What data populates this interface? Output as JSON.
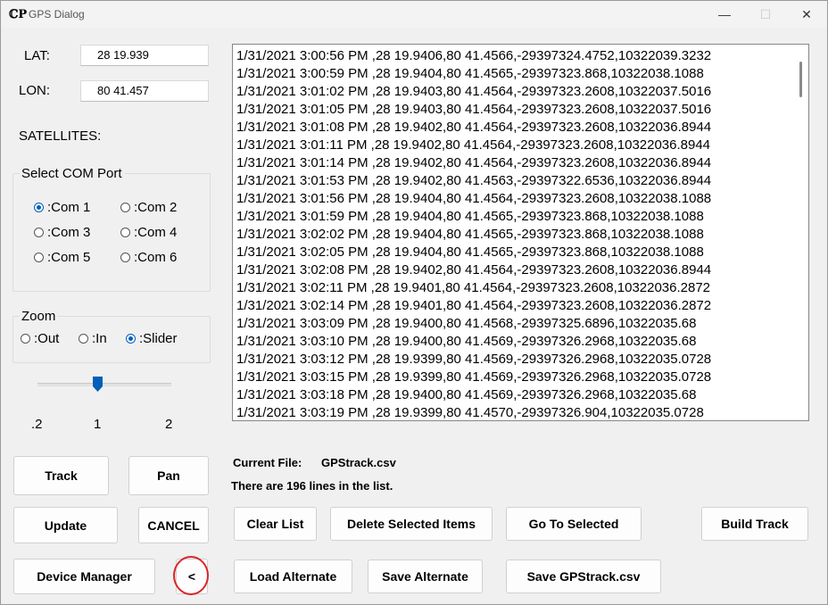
{
  "window": {
    "title": "GPS Dialog",
    "app_icon_glyph": "ℂP",
    "controls": {
      "minimize": "—",
      "maximize": "☐",
      "close": "✕"
    }
  },
  "position": {
    "lat_label": "LAT:",
    "lat_value": "28 19.939",
    "lon_label": "LON:",
    "lon_value": "80 41.457",
    "satellites_label": "SATELLITES:"
  },
  "com_port": {
    "title": "Select COM Port",
    "options": [
      ":Com 1",
      ":Com 2",
      ":Com 3",
      ":Com 4",
      ":Com 5",
      ":Com 6"
    ],
    "selected_index": 0
  },
  "zoom": {
    "title": "Zoom",
    "options": [
      ":Out",
      ":In",
      ":Slider"
    ],
    "selected_index": 2,
    "slider": {
      "min_label": ".2",
      "mid_label": "1",
      "max_label": "2",
      "value": 1
    }
  },
  "buttons": {
    "track": "Track",
    "pan": "Pan",
    "update": "Update",
    "cancel": "CANCEL",
    "device_manager": "Device Manager",
    "collapse": "<",
    "clear_list": "Clear List",
    "delete_selected": "Delete Selected Items",
    "go_to_selected": "Go To  Selected",
    "build_track": "Build Track",
    "load_alternate": "Load Alternate",
    "save_alternate": "Save Alternate",
    "save_gpstrack": "Save GPStrack.csv"
  },
  "file_info": {
    "current_file_label": "Current File:",
    "current_file_name": "GPStrack.csv",
    "line_count_text": "There are 196 lines in the list."
  },
  "list": {
    "items": [
      "1/31/2021 3:00:56 PM ,28 19.9406,80 41.4566,-29397324.4752,10322039.3232",
      "1/31/2021 3:00:59 PM ,28 19.9404,80 41.4565,-29397323.868,10322038.1088",
      "1/31/2021 3:01:02 PM ,28 19.9403,80 41.4564,-29397323.2608,10322037.5016",
      "1/31/2021 3:01:05 PM ,28 19.9403,80 41.4564,-29397323.2608,10322037.5016",
      "1/31/2021 3:01:08 PM ,28 19.9402,80 41.4564,-29397323.2608,10322036.8944",
      "1/31/2021 3:01:11 PM ,28 19.9402,80 41.4564,-29397323.2608,10322036.8944",
      "1/31/2021 3:01:14 PM ,28 19.9402,80 41.4564,-29397323.2608,10322036.8944",
      "1/31/2021 3:01:53 PM ,28 19.9402,80 41.4563,-29397322.6536,10322036.8944",
      "1/31/2021 3:01:56 PM ,28 19.9404,80 41.4564,-29397323.2608,10322038.1088",
      "1/31/2021 3:01:59 PM ,28 19.9404,80 41.4565,-29397323.868,10322038.1088",
      "1/31/2021 3:02:02 PM ,28 19.9404,80 41.4565,-29397323.868,10322038.1088",
      "1/31/2021 3:02:05 PM ,28 19.9404,80 41.4565,-29397323.868,10322038.1088",
      "1/31/2021 3:02:08 PM ,28 19.9402,80 41.4564,-29397323.2608,10322036.8944",
      "1/31/2021 3:02:11 PM ,28 19.9401,80 41.4564,-29397323.2608,10322036.2872",
      "1/31/2021 3:02:14 PM ,28 19.9401,80 41.4564,-29397323.2608,10322036.2872",
      "1/31/2021 3:03:09 PM ,28 19.9400,80 41.4568,-29397325.6896,10322035.68",
      "1/31/2021 3:03:10 PM ,28 19.9400,80 41.4569,-29397326.2968,10322035.68",
      "1/31/2021 3:03:12 PM ,28 19.9399,80 41.4569,-29397326.2968,10322035.0728",
      "1/31/2021 3:03:15 PM ,28 19.9399,80 41.4569,-29397326.2968,10322035.0728",
      "1/31/2021 3:03:18 PM ,28 19.9400,80 41.4569,-29397326.2968,10322035.68",
      "1/31/2021 3:03:19 PM ,28 19.9399,80 41.4570,-29397326.904,10322035.0728"
    ]
  },
  "colors": {
    "accent": "#005fb8",
    "highlight_circle": "#d8262a"
  },
  "icons": {
    "app": "app-logo-icon",
    "slider_thumb": "slider-thumb-icon"
  }
}
